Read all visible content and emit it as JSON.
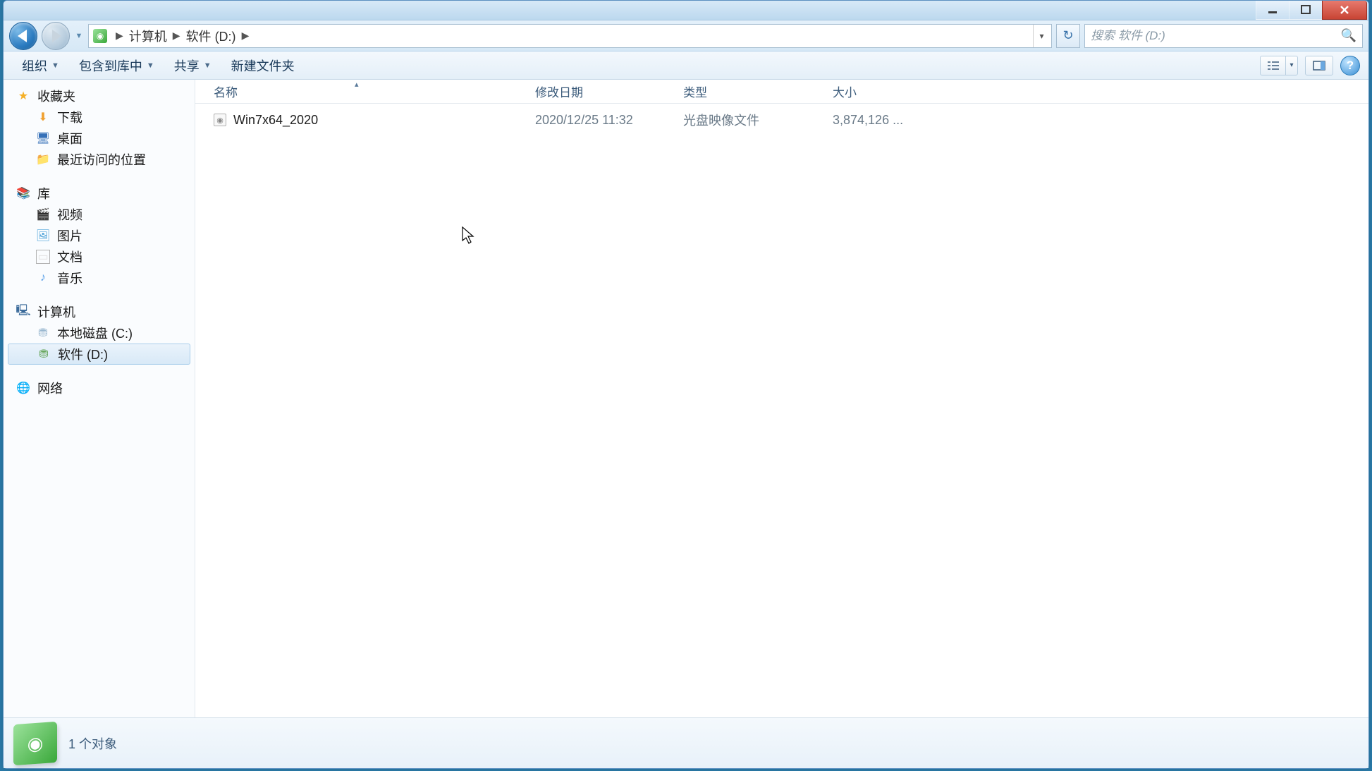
{
  "breadcrumb": {
    "part1": "计算机",
    "part2": "软件 (D:)"
  },
  "search": {
    "placeholder": "搜索 软件 (D:)"
  },
  "toolbar": {
    "organize": "组织",
    "include": "包含到库中",
    "share": "共享",
    "newfolder": "新建文件夹"
  },
  "columns": {
    "name": "名称",
    "date": "修改日期",
    "type": "类型",
    "size": "大小"
  },
  "sidebar": {
    "favorites": "收藏夹",
    "downloads": "下载",
    "desktop": "桌面",
    "recent": "最近访问的位置",
    "libraries": "库",
    "videos": "视频",
    "pictures": "图片",
    "documents": "文档",
    "music": "音乐",
    "computer": "计算机",
    "drive_c": "本地磁盘 (C:)",
    "drive_d": "软件 (D:)",
    "network": "网络"
  },
  "files": [
    {
      "name": "Win7x64_2020",
      "date": "2020/12/25 11:32",
      "type": "光盘映像文件",
      "size": "3,874,126 ..."
    }
  ],
  "status": {
    "count": "1 个对象"
  }
}
